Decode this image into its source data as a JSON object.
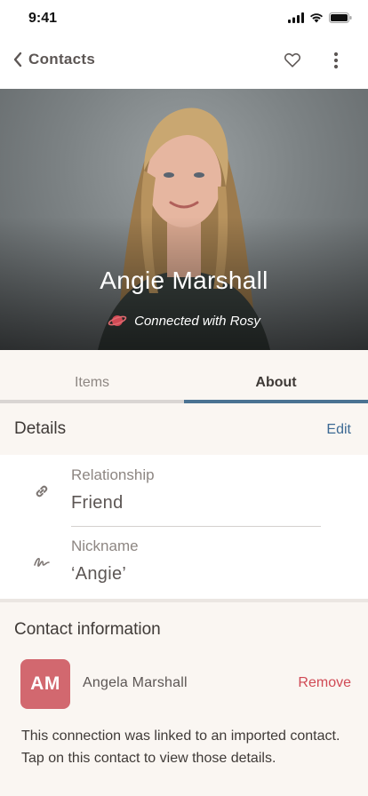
{
  "status_bar": {
    "time": "9:41"
  },
  "nav": {
    "back_label": "Contacts"
  },
  "profile": {
    "name": "Angie Marshall",
    "connection_text": "Connected with Rosy"
  },
  "tabs": [
    {
      "label": "Items",
      "active": false
    },
    {
      "label": "About",
      "active": true
    }
  ],
  "details": {
    "title": "Details",
    "edit_label": "Edit",
    "fields": [
      {
        "label": "Relationship",
        "value": "Friend",
        "icon": "link-icon"
      },
      {
        "label": "Nickname",
        "value": "‘Angie’",
        "icon": "signature-icon"
      }
    ]
  },
  "contact_info": {
    "title": "Contact information",
    "avatar_initials": "AM",
    "contact_name": "Angela Marshall",
    "remove_label": "Remove",
    "note": "This connection was linked to an imported contact. Tap on this contact to view those details."
  },
  "colors": {
    "accent": "#4a7292",
    "link": "#3d6a94",
    "danger": "#d04a55",
    "avatar_bg": "#d2686f",
    "section_bg": "#faf6f2"
  }
}
